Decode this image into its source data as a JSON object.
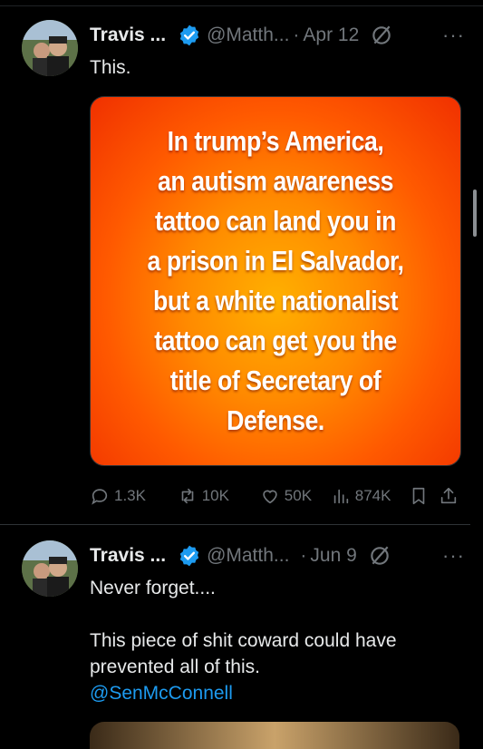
{
  "tweets": [
    {
      "name": "Travis ...",
      "handle": "@Matth...",
      "separator": "·",
      "date": "Apr 12",
      "text": "This.",
      "image_text": "In trump’s America,\nan autism awareness\ntattoo can land you in\na prison in El Salvador,\nbut a white nationalist\ntattoo can get you the\ntitle of Secretary of\nDefense.",
      "stats": {
        "replies": "1.3K",
        "reposts": "10K",
        "likes": "50K",
        "views": "874K"
      }
    },
    {
      "name": "Travis ...",
      "handle": "@Matth...",
      "separator": "·",
      "date": "Jun 9",
      "text_line1": "Never forget....",
      "text_line2": "This piece of shit coward could have prevented all of this.",
      "mention": "@SenMcConnell"
    }
  ],
  "icons": [
    "verified-badge-icon",
    "grok-icon",
    "more-icon",
    "reply-icon",
    "repost-icon",
    "like-icon",
    "views-icon",
    "bookmark-icon",
    "share-icon"
  ],
  "colors": {
    "accent": "#1d9bf0",
    "background": "#000000",
    "muted": "#71767b"
  }
}
